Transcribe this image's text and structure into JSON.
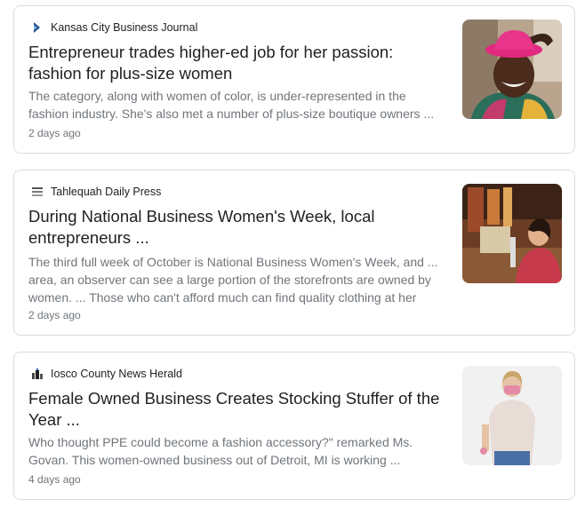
{
  "articles": [
    {
      "source": "Kansas City Business Journal",
      "favicon": "kcbj-logo-icon",
      "headline_line1": "Entrepreneur trades higher-ed job for her passion:",
      "headline_line2": "fashion for plus-size women",
      "snippet_line1": "The category, along with women of color, is under-represented in the",
      "snippet_line2": "fashion industry. She's also met a number of plus-size boutique owners ...",
      "time": "2 days ago",
      "thumbnail": "woman-pink-hat-photo"
    },
    {
      "source": "Tahlequah Daily Press",
      "favicon": "daily-press-logo-icon",
      "headline_line1": "During National Business Women's Week, local",
      "headline_line2": "entrepreneurs ...",
      "snippet_line1": "The third full week of October is National Business Women's Week, and ...",
      "snippet_line2": "area, an observer can see a large portion of the storefronts are owned by",
      "snippet_line3": "women. ... Those who can't afford much can find quality clothing at her",
      "time": "2 days ago",
      "thumbnail": "shop-owner-photo"
    },
    {
      "source": "Iosco County News Herald",
      "favicon": "news-herald-logo-icon",
      "headline_line1": "Female Owned Business Creates Stocking Stuffer of the",
      "headline_line2": "Year ...",
      "snippet_line1": "Who thought PPE could become a fashion accessory?\" remarked Ms.",
      "snippet_line2": "Govan. This women-owned business out of Detroit, MI is working ...",
      "time": "4 days ago",
      "thumbnail": "woman-face-mask-photo"
    }
  ]
}
